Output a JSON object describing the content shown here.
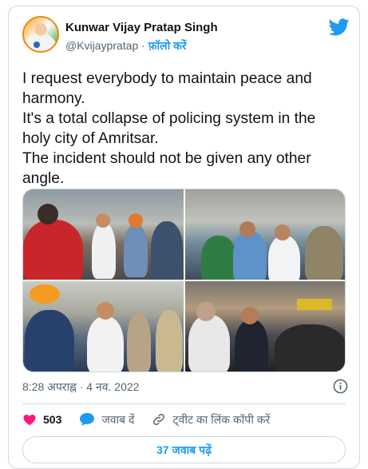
{
  "author": {
    "name": "Kunwar Vijay Pratap Singh",
    "handle": "@Kvijaypratap",
    "separator": " · ",
    "follow_label": "फ़ॉलो करें",
    "avatar_icon": "profile-avatar"
  },
  "brand_icon": "twitter-bird-icon",
  "tweet": {
    "lines": [
      "I request everybody to maintain peace and harmony.",
      "It's a total collapse of policing system in the holy city of Amritsar.",
      "The incident should not be given any other angle."
    ]
  },
  "media": {
    "count": 4,
    "photos": [
      "street-crowd-photo",
      "officials-meeting-photo",
      "press-interaction-photo",
      "media-scrum-photo"
    ]
  },
  "timestamp": "8:28 अपराह्न · 4 नव. 2022",
  "actions": {
    "like_count": "503",
    "reply_label": "जवाब दें",
    "copy_link_label": "ट्वीट का लिंक कॉपी करें"
  },
  "read_replies_label": "37 जवाब पढ़ें",
  "colors": {
    "accent": "#1d9bf0",
    "like": "#f91880",
    "text": "#0f1419",
    "muted": "#536471",
    "border": "#cfd9de"
  }
}
